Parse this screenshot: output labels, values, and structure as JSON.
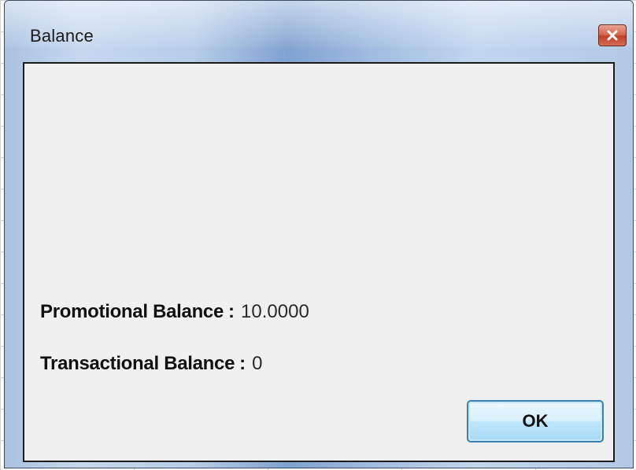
{
  "window": {
    "title": "Balance",
    "close_icon": "close-icon"
  },
  "balances": {
    "promotional": {
      "label": "Promotional Balance",
      "separator": ":",
      "value": "10.0000"
    },
    "transactional": {
      "label": "Transactional Balance",
      "separator": ":",
      "value": "0"
    }
  },
  "buttons": {
    "ok_label": "OK"
  },
  "colors": {
    "titlebar_accent": "#7fa2d0",
    "client_background": "#f0f0f0",
    "close_button": "#c0402a",
    "ok_button_border": "#3c7fb1"
  }
}
